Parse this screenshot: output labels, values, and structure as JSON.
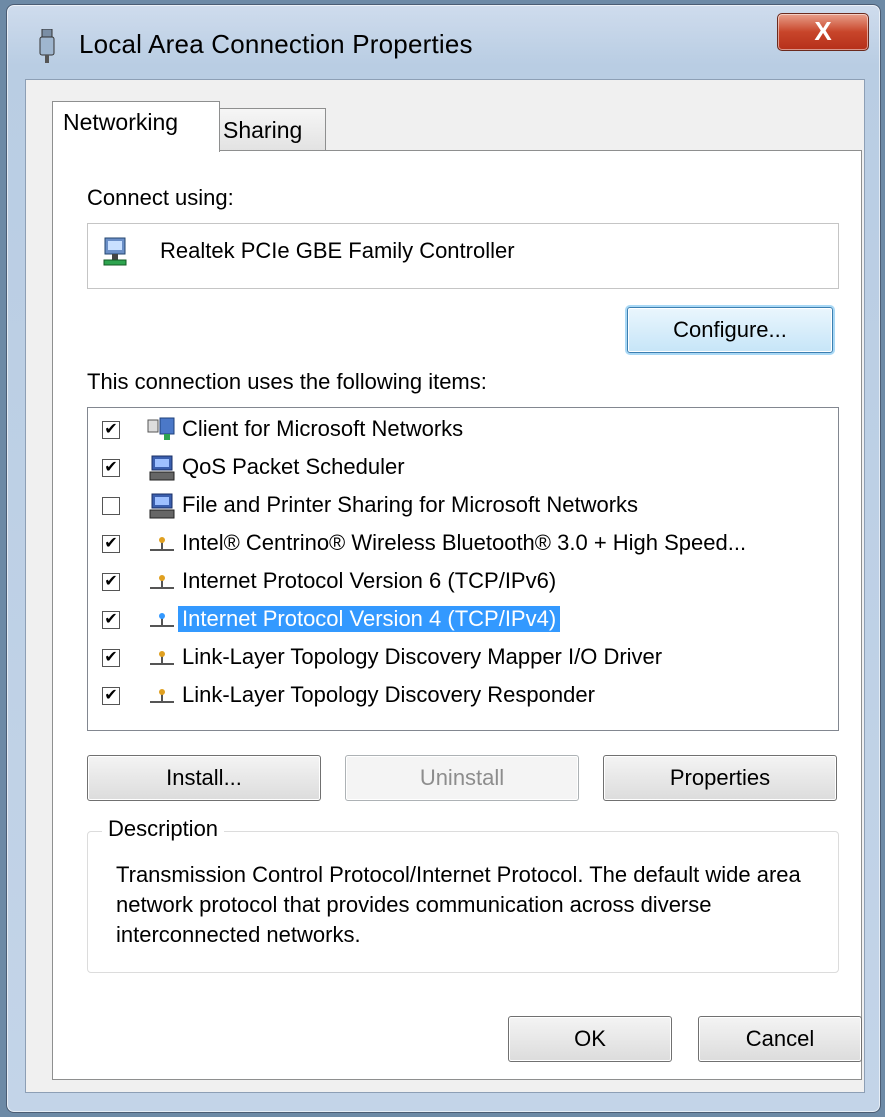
{
  "window": {
    "title": "Local Area Connection Properties",
    "close_label": "X"
  },
  "tabs": [
    {
      "label": "Networking",
      "active": true
    },
    {
      "label": "Sharing",
      "active": false
    }
  ],
  "connect_using": {
    "label": "Connect using:",
    "adapter": "Realtek PCIe GBE Family Controller"
  },
  "configure_button": "Configure...",
  "items_label": "This connection uses the following items:",
  "items": [
    {
      "label": "Client for Microsoft Networks",
      "checked": true,
      "icon": "network-client-icon"
    },
    {
      "label": "QoS Packet Scheduler",
      "checked": true,
      "icon": "service-icon"
    },
    {
      "label": "File and Printer Sharing for Microsoft Networks",
      "checked": false,
      "icon": "service-icon"
    },
    {
      "label": "Intel® Centrino® Wireless Bluetooth® 3.0 + High Speed...",
      "checked": true,
      "icon": "protocol-icon"
    },
    {
      "label": "Internet Protocol Version 6 (TCP/IPv6)",
      "checked": true,
      "icon": "protocol-icon"
    },
    {
      "label": "Internet Protocol Version 4 (TCP/IPv4)",
      "checked": true,
      "icon": "protocol-icon",
      "selected": true
    },
    {
      "label": "Link-Layer Topology Discovery Mapper I/O Driver",
      "checked": true,
      "icon": "protocol-icon"
    },
    {
      "label": "Link-Layer Topology Discovery Responder",
      "checked": true,
      "icon": "protocol-icon"
    }
  ],
  "buttons": {
    "install": "Install...",
    "uninstall": "Uninstall",
    "properties": "Properties",
    "ok": "OK",
    "cancel": "Cancel"
  },
  "description": {
    "legend": "Description",
    "text": "Transmission Control Protocol/Internet Protocol. The default wide area network protocol that provides communication across diverse interconnected networks."
  },
  "colors": {
    "selection": "#3399ff",
    "close_button": "#c8452a",
    "title_bar": "#b9cde3"
  }
}
